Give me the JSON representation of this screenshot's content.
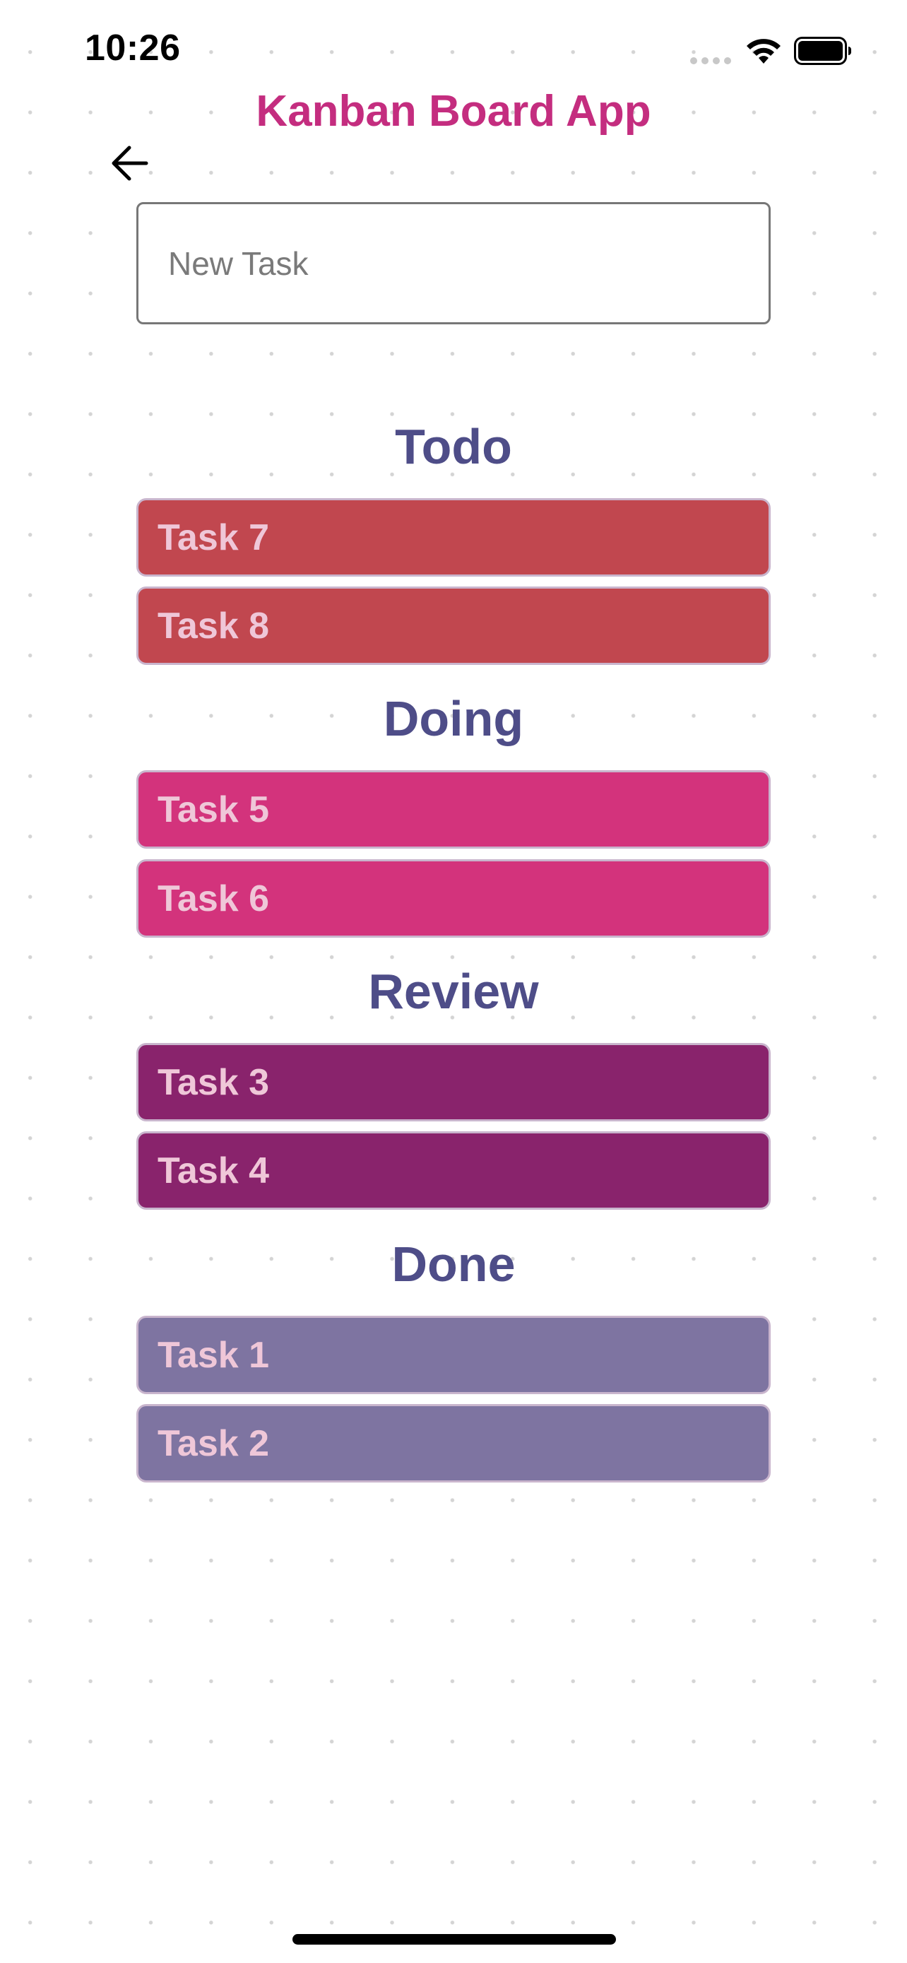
{
  "status_bar": {
    "time": "10:26"
  },
  "header": {
    "title": "Kanban Board App"
  },
  "input": {
    "value": "",
    "placeholder": "New Task"
  },
  "columns": {
    "todo": {
      "title": "Todo",
      "tasks": [
        "Task 7",
        "Task 8"
      ],
      "color": "#c1474f"
    },
    "doing": {
      "title": "Doing",
      "tasks": [
        "Task 5",
        "Task 6"
      ],
      "color": "#d3337c"
    },
    "review": {
      "title": "Review",
      "tasks": [
        "Task 3",
        "Task 4"
      ],
      "color": "#89236c"
    },
    "done": {
      "title": "Done",
      "tasks": [
        "Task 1",
        "Task 2"
      ],
      "color": "#7e74a1"
    }
  },
  "colors": {
    "title": "#c42d7f",
    "column_heading": "#4e4d88",
    "card_text": "#efc7d8"
  },
  "icons": {
    "back": "arrow-left-icon",
    "wifi": "wifi-icon",
    "battery": "battery-icon",
    "signal": "cellular-signal-icon"
  }
}
